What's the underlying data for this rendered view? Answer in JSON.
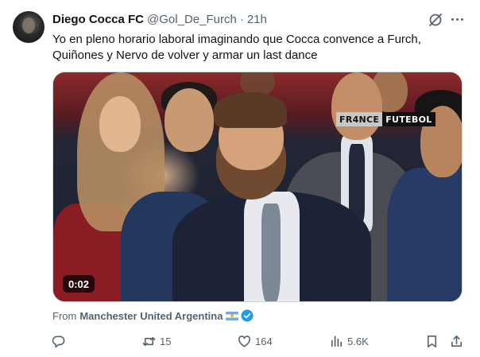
{
  "tweet": {
    "display_name": "Diego Cocca FC",
    "handle": "@Gol_De_Furch",
    "separator": "·",
    "time": "21h",
    "text": "Yo en pleno horario laboral imaginando que Cocca convence a Furch, Quiñones y Nervo de volver y armar un last dance"
  },
  "media": {
    "watermark_left": "FR4NCE",
    "watermark_right": "FUTEBOL",
    "duration": "0:02"
  },
  "attribution": {
    "from_label": "From",
    "source": "Manchester United Argentina",
    "flag_icon": "argentina-flag-icon",
    "verified_icon": "verified-badge-icon",
    "verified_color": "#1d9bf0"
  },
  "actions": {
    "reply_count": "",
    "retweet_count": "15",
    "like_count": "164",
    "views_count": "5.6K"
  },
  "colors": {
    "text_primary": "#0f1419",
    "text_secondary": "#536471",
    "border": "#cfd9de"
  }
}
